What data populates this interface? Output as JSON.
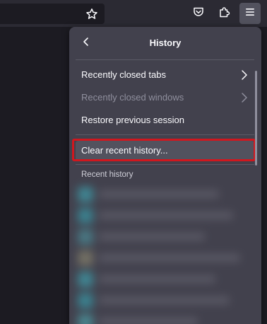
{
  "toolbar": {
    "icons": [
      "bookmark-star-icon",
      "pocket-icon",
      "extensions-icon",
      "hamburger-menu-icon"
    ]
  },
  "panel": {
    "title": "History",
    "back_icon": "chevron-left-icon",
    "items": [
      {
        "label": "Recently closed tabs",
        "disabled": false,
        "has_submenu": true
      },
      {
        "label": "Recently closed windows",
        "disabled": true,
        "has_submenu": true
      },
      {
        "label": "Restore previous session",
        "disabled": false,
        "has_submenu": false
      }
    ],
    "clear_label": "Clear recent history...",
    "section_title": "Recent history"
  },
  "colors": {
    "panel_bg": "#42414d",
    "toolbar_bg": "#2b2a33",
    "highlight": "#d1171e"
  }
}
